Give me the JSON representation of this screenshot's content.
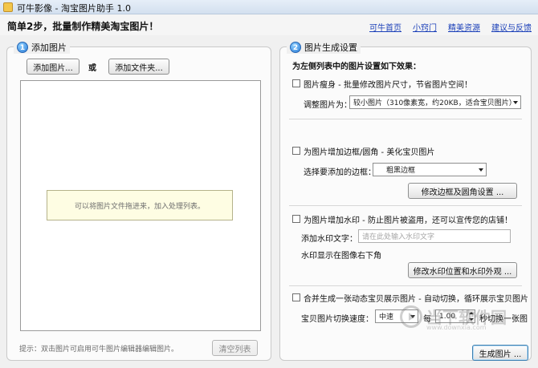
{
  "window": {
    "title": "可牛影像 - 淘宝图片助手 1.0"
  },
  "header": {
    "step": "简单2步，批量制作精美淘宝图片！",
    "links": [
      "可牛首页",
      "小窍门",
      "精美资源",
      "建议与反馈"
    ]
  },
  "left": {
    "panel_num": "1",
    "panel_title": "添加图片",
    "add_images_btn": "添加图片...",
    "or_label": "或",
    "add_folder_btn": "添加文件夹...",
    "drop_hint": "可以将图片文件拖进来，加入处理列表。",
    "tip": "提示：双击图片可启用可牛图片编辑器编辑图片。",
    "clear_btn": "清空列表"
  },
  "right": {
    "panel_num": "2",
    "panel_title": "图片生成设置",
    "heading": "为左侧列表中的图片设置如下效果：",
    "resize": {
      "checkbox_label": "图片瘦身 - 批量修改图片尺寸，节省图片空间！",
      "size_label": "调整图片为：",
      "size_value": "较小图片（310像素宽，约20KB，适合宝贝图片）"
    },
    "border": {
      "checkbox_label": "为图片增加边框/圆角 - 美化宝贝图片",
      "choose_label": "选择要添加的边框：",
      "choose_value": "粗黑边框",
      "edit_btn": "修改边框及圆角设置 ..."
    },
    "watermark": {
      "checkbox_label": "为图片增加水印 - 防止图片被盗用，还可以宣传您的店铺！",
      "text_label": "添加水印文字：",
      "text_placeholder": "请在此处输入水印文字",
      "position_text": "水印显示在图像右下角",
      "edit_btn": "修改水印位置和水印外观 ..."
    },
    "animation": {
      "checkbox_label": "合并生成一张动态宝贝展示图片 - 自动切换，循环展示宝贝图片",
      "speed_label": "宝贝图片切换速度：",
      "speed_value": "中速",
      "every_label": "每",
      "interval_value": "1.00",
      "interval_suffix": "秒切换一张图"
    },
    "generate_btn": "生成图片 ..."
  },
  "watermark_logo": {
    "main": "当下软件园",
    "sub": "www.downxia.com"
  }
}
